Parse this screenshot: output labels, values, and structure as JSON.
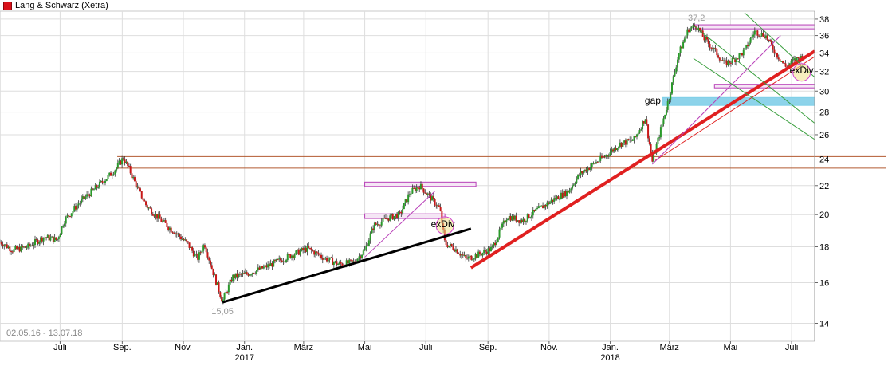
{
  "legend": {
    "label": "Lang & Schwarz (Xetra)",
    "color": "#d9121b"
  },
  "date_range_label": "02.05.16 - 13.07.18",
  "chart_data": {
    "type": "candlestick",
    "yscale": "log",
    "ylim": [
      13.2,
      39.0
    ],
    "yticks": [
      14,
      16,
      18,
      20,
      22,
      24,
      26,
      28,
      30,
      32,
      34,
      36,
      38
    ],
    "xlim": [
      "2016-05-02",
      "2018-07-24"
    ],
    "xticks": [
      {
        "date": "2016-07-01",
        "label": "Juli",
        "sub": ""
      },
      {
        "date": "2016-09-01",
        "label": "Sep.",
        "sub": ""
      },
      {
        "date": "2016-11-01",
        "label": "Nov.",
        "sub": ""
      },
      {
        "date": "2017-01-01",
        "label": "Jan.",
        "sub": "2017"
      },
      {
        "date": "2017-03-01",
        "label": "März",
        "sub": ""
      },
      {
        "date": "2017-05-01",
        "label": "Mai",
        "sub": ""
      },
      {
        "date": "2017-07-01",
        "label": "Juli",
        "sub": ""
      },
      {
        "date": "2017-09-01",
        "label": "Sep.",
        "sub": ""
      },
      {
        "date": "2017-11-01",
        "label": "Nov.",
        "sub": ""
      },
      {
        "date": "2018-01-01",
        "label": "Jan.",
        "sub": "2018"
      },
      {
        "date": "2018-03-01",
        "label": "März",
        "sub": ""
      },
      {
        "date": "2018-05-01",
        "label": "Mai",
        "sub": ""
      },
      {
        "date": "2018-07-01",
        "label": "Juli",
        "sub": ""
      }
    ],
    "grid": true,
    "series_path": [
      [
        "2016-05-02",
        18.3
      ],
      [
        "2016-05-15",
        17.8
      ],
      [
        "2016-05-30",
        18.0
      ],
      [
        "2016-06-15",
        18.6
      ],
      [
        "2016-06-28",
        18.4
      ],
      [
        "2016-07-05",
        19.6
      ],
      [
        "2016-07-20",
        20.8
      ],
      [
        "2016-08-05",
        21.8
      ],
      [
        "2016-08-20",
        22.8
      ],
      [
        "2016-08-27",
        23.4
      ],
      [
        "2016-09-02",
        24.1
      ],
      [
        "2016-09-08",
        23.2
      ],
      [
        "2016-09-15",
        22.0
      ],
      [
        "2016-09-25",
        20.6
      ],
      [
        "2016-10-10",
        19.6
      ],
      [
        "2016-10-25",
        18.8
      ],
      [
        "2016-11-05",
        18.2
      ],
      [
        "2016-11-15",
        17.3
      ],
      [
        "2016-11-22",
        18.2
      ],
      [
        "2016-12-01",
        16.5
      ],
      [
        "2016-12-10",
        15.05
      ],
      [
        "2016-12-20",
        16.3
      ],
      [
        "2017-01-05",
        16.5
      ],
      [
        "2017-01-20",
        16.8
      ],
      [
        "2017-02-05",
        17.2
      ],
      [
        "2017-02-20",
        17.6
      ],
      [
        "2017-03-05",
        17.9
      ],
      [
        "2017-03-20",
        17.4
      ],
      [
        "2017-04-05",
        17.0
      ],
      [
        "2017-04-20",
        17.1
      ],
      [
        "2017-05-01",
        17.8
      ],
      [
        "2017-05-10",
        19.3
      ],
      [
        "2017-05-25",
        19.8
      ],
      [
        "2017-06-05",
        20.0
      ],
      [
        "2017-06-15",
        21.5
      ],
      [
        "2017-06-25",
        22.0
      ],
      [
        "2017-07-05",
        21.2
      ],
      [
        "2017-07-15",
        20.4
      ],
      [
        "2017-07-20",
        18.2
      ],
      [
        "2017-07-30",
        17.9
      ],
      [
        "2017-08-10",
        17.3
      ],
      [
        "2017-08-25",
        17.6
      ],
      [
        "2017-09-05",
        17.9
      ],
      [
        "2017-09-20",
        19.9
      ],
      [
        "2017-10-05",
        19.6
      ],
      [
        "2017-10-20",
        20.3
      ],
      [
        "2017-11-05",
        21.0
      ],
      [
        "2017-11-20",
        21.6
      ],
      [
        "2017-12-01",
        22.8
      ],
      [
        "2017-12-15",
        23.6
      ],
      [
        "2017-12-28",
        24.3
      ],
      [
        "2018-01-10",
        25.2
      ],
      [
        "2018-01-25",
        25.6
      ],
      [
        "2018-02-05",
        27.5
      ],
      [
        "2018-02-12",
        23.8
      ],
      [
        "2018-02-22",
        27.0
      ],
      [
        "2018-03-01",
        29.5
      ],
      [
        "2018-03-10",
        33.8
      ],
      [
        "2018-03-20",
        36.8
      ],
      [
        "2018-03-28",
        37.2
      ],
      [
        "2018-04-05",
        35.6
      ],
      [
        "2018-04-15",
        34.3
      ],
      [
        "2018-04-25",
        32.8
      ],
      [
        "2018-05-05",
        33.3
      ],
      [
        "2018-05-15",
        34.2
      ],
      [
        "2018-05-25",
        36.5
      ],
      [
        "2018-06-05",
        36.0
      ],
      [
        "2018-06-15",
        34.0
      ],
      [
        "2018-06-25",
        32.5
      ],
      [
        "2018-07-05",
        33.3
      ],
      [
        "2018-07-13",
        33.6
      ]
    ],
    "annotations": [
      {
        "kind": "label",
        "text": "37,2",
        "date": "2018-03-28",
        "value": 37.2
      },
      {
        "kind": "label",
        "text": "15,05",
        "date": "2016-12-10",
        "value": 15.05
      },
      {
        "kind": "label",
        "text": "exDiv",
        "date": "2017-07-18",
        "value": 19.2
      },
      {
        "kind": "label",
        "text": "exDiv",
        "date": "2018-07-11",
        "value": 31.8
      },
      {
        "kind": "label",
        "text": "gap",
        "date": "2018-02-22",
        "value": 29.1
      },
      {
        "kind": "hline",
        "color": "#b25a30",
        "value": 24.2,
        "from": "2016-08-27"
      },
      {
        "kind": "hline",
        "color": "#b25a30",
        "value": 23.3,
        "from": "2016-08-27"
      },
      {
        "kind": "zone",
        "color": "#7fd0e8",
        "from": "2018-02-22",
        "low": 28.7,
        "high": 29.3
      },
      {
        "kind": "zone",
        "color": "#b83fb8",
        "from": "2017-05-01",
        "to": "2017-08-20",
        "low": 22.0,
        "high": 22.2
      },
      {
        "kind": "zone",
        "color": "#b83fb8",
        "from": "2017-05-01",
        "to": "2017-07-20",
        "low": 19.8,
        "high": 20.0
      },
      {
        "kind": "zone",
        "color": "#b83fb8",
        "from": "2018-03-25",
        "low": 36.9,
        "high": 37.2
      },
      {
        "kind": "zone",
        "color": "#b83fb8",
        "from": "2018-04-15",
        "low": 30.4,
        "high": 30.6
      },
      {
        "kind": "trend",
        "color": "#000000",
        "from": [
          "2016-12-10",
          15.0
        ],
        "to": [
          "2017-08-15",
          19.1
        ]
      },
      {
        "kind": "trend",
        "color": "#e02020",
        "from": [
          "2017-08-15",
          16.8
        ],
        "to": [
          "2018-07-24",
          34.2
        ]
      },
      {
        "kind": "trend",
        "color": "#e02020",
        "from": [
          "2018-02-15",
          23.9
        ],
        "to": [
          "2018-07-24",
          33.6
        ]
      },
      {
        "kind": "trend",
        "color": "#b83fb8",
        "from": [
          "2017-05-01",
          17.4
        ],
        "to": [
          "2017-07-10",
          21.6
        ]
      },
      {
        "kind": "trend",
        "color": "#b83fb8",
        "from": [
          "2018-02-12",
          23.6
        ],
        "to": [
          "2018-06-20",
          36.0
        ]
      },
      {
        "kind": "trend",
        "color": "#3ca040",
        "from": [
          "2018-03-25",
          37.2
        ],
        "to": [
          "2018-07-24",
          27.0
        ]
      },
      {
        "kind": "trend",
        "color": "#3ca040",
        "from": [
          "2018-03-25",
          33.4
        ],
        "to": [
          "2018-07-24",
          25.6
        ]
      },
      {
        "kind": "trend",
        "color": "#3ca040",
        "from": [
          "2018-05-15",
          38.8
        ],
        "to": [
          "2018-07-24",
          31.4
        ]
      },
      {
        "kind": "circle",
        "color": "#f0e38a",
        "date": "2017-07-20",
        "value": 19.3
      },
      {
        "kind": "circle",
        "color": "#f0e38a",
        "date": "2018-07-11",
        "value": 31.9
      }
    ]
  }
}
